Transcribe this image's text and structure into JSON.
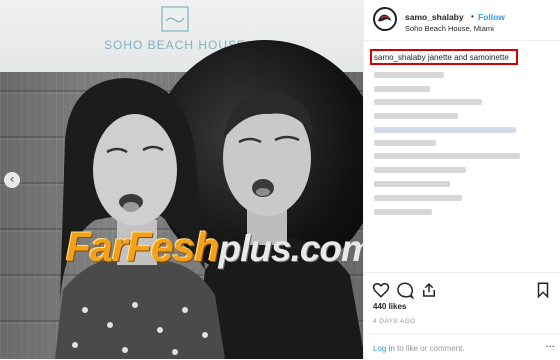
{
  "photo": {
    "venue_logo_text": "SOHO BEACH HOUSE",
    "prev_arrow_glyph": "‹",
    "watermark_brand": "FarFesh",
    "watermark_tail": "plus.com"
  },
  "post": {
    "username": "samo_shalaby",
    "separator": "•",
    "follow_label": "Follow",
    "location": "Soho Beach House, Miami",
    "caption_user": "samo_shalaby",
    "caption_text": "janette and samoinette",
    "likes": "440 likes",
    "time_ago": "4 DAYS AGO",
    "footer_link": "Log in",
    "footer_text": "to like or comment.",
    "more_glyph": "···"
  },
  "icons": {
    "like": "heart-icon",
    "comment": "comment-icon",
    "share": "share-icon",
    "save": "bookmark-icon"
  },
  "colors": {
    "link_blue": "#3897f0",
    "highlight_red": "#d60000",
    "logo_teal": "#7fb2bf",
    "watermark_orange": "#f2a11c"
  }
}
